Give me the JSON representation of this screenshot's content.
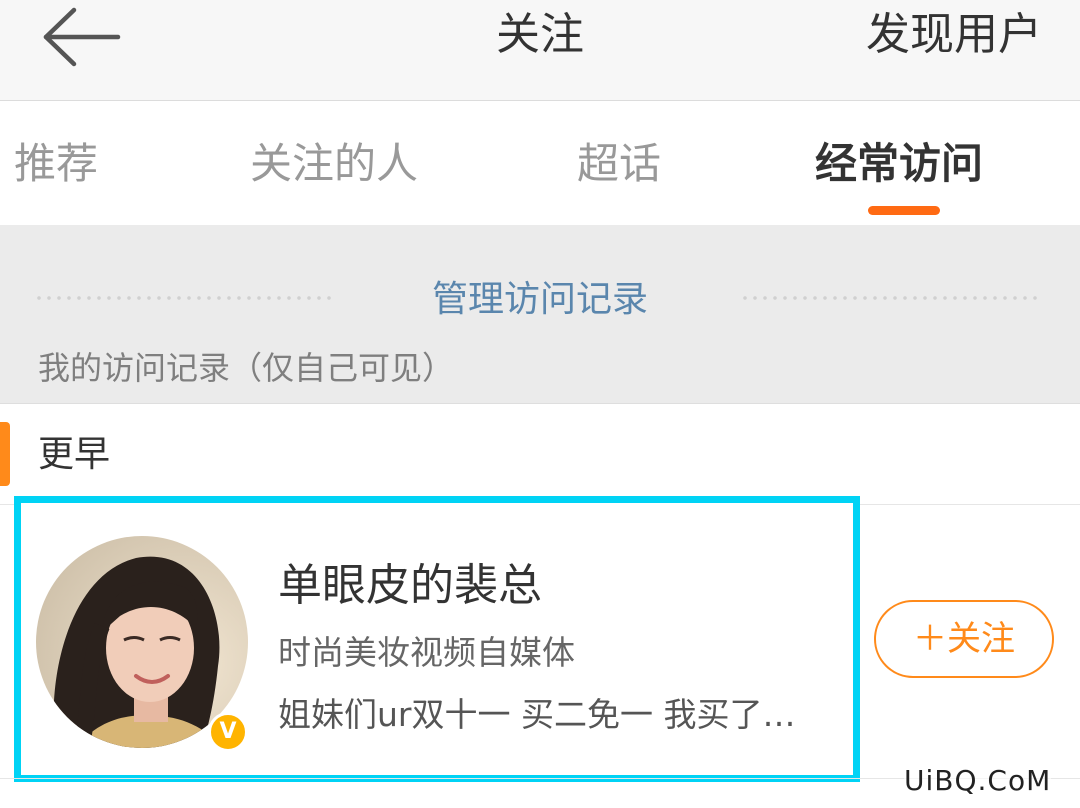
{
  "header": {
    "title": "关注",
    "right_action": "发现用户",
    "back_icon": "arrow-left-icon"
  },
  "tabs": [
    {
      "label": "推荐",
      "active": false
    },
    {
      "label": "关注的人",
      "active": false
    },
    {
      "label": "超话",
      "active": false
    },
    {
      "label": "经常访问",
      "active": true
    }
  ],
  "visits": {
    "manage_label": "管理访问记录",
    "my_records_label": "我的访问记录（仅自己可见）",
    "section_title": "更早"
  },
  "user": {
    "name": "单眼皮的裴总",
    "description": "时尚美妆视频自媒体",
    "latest_post": "姐妹们ur双十一 买二免一 我买了…",
    "verified_badge": "V",
    "follow_label": "＋关注"
  },
  "watermark": "UiBQ.CoM",
  "colors": {
    "accent_orange": "#ff8a1a",
    "tab_indicator": "#ff6a13",
    "highlight_border": "#00d3f5",
    "link_blue": "#5a86ad",
    "badge_yellow": "#ffb400"
  }
}
